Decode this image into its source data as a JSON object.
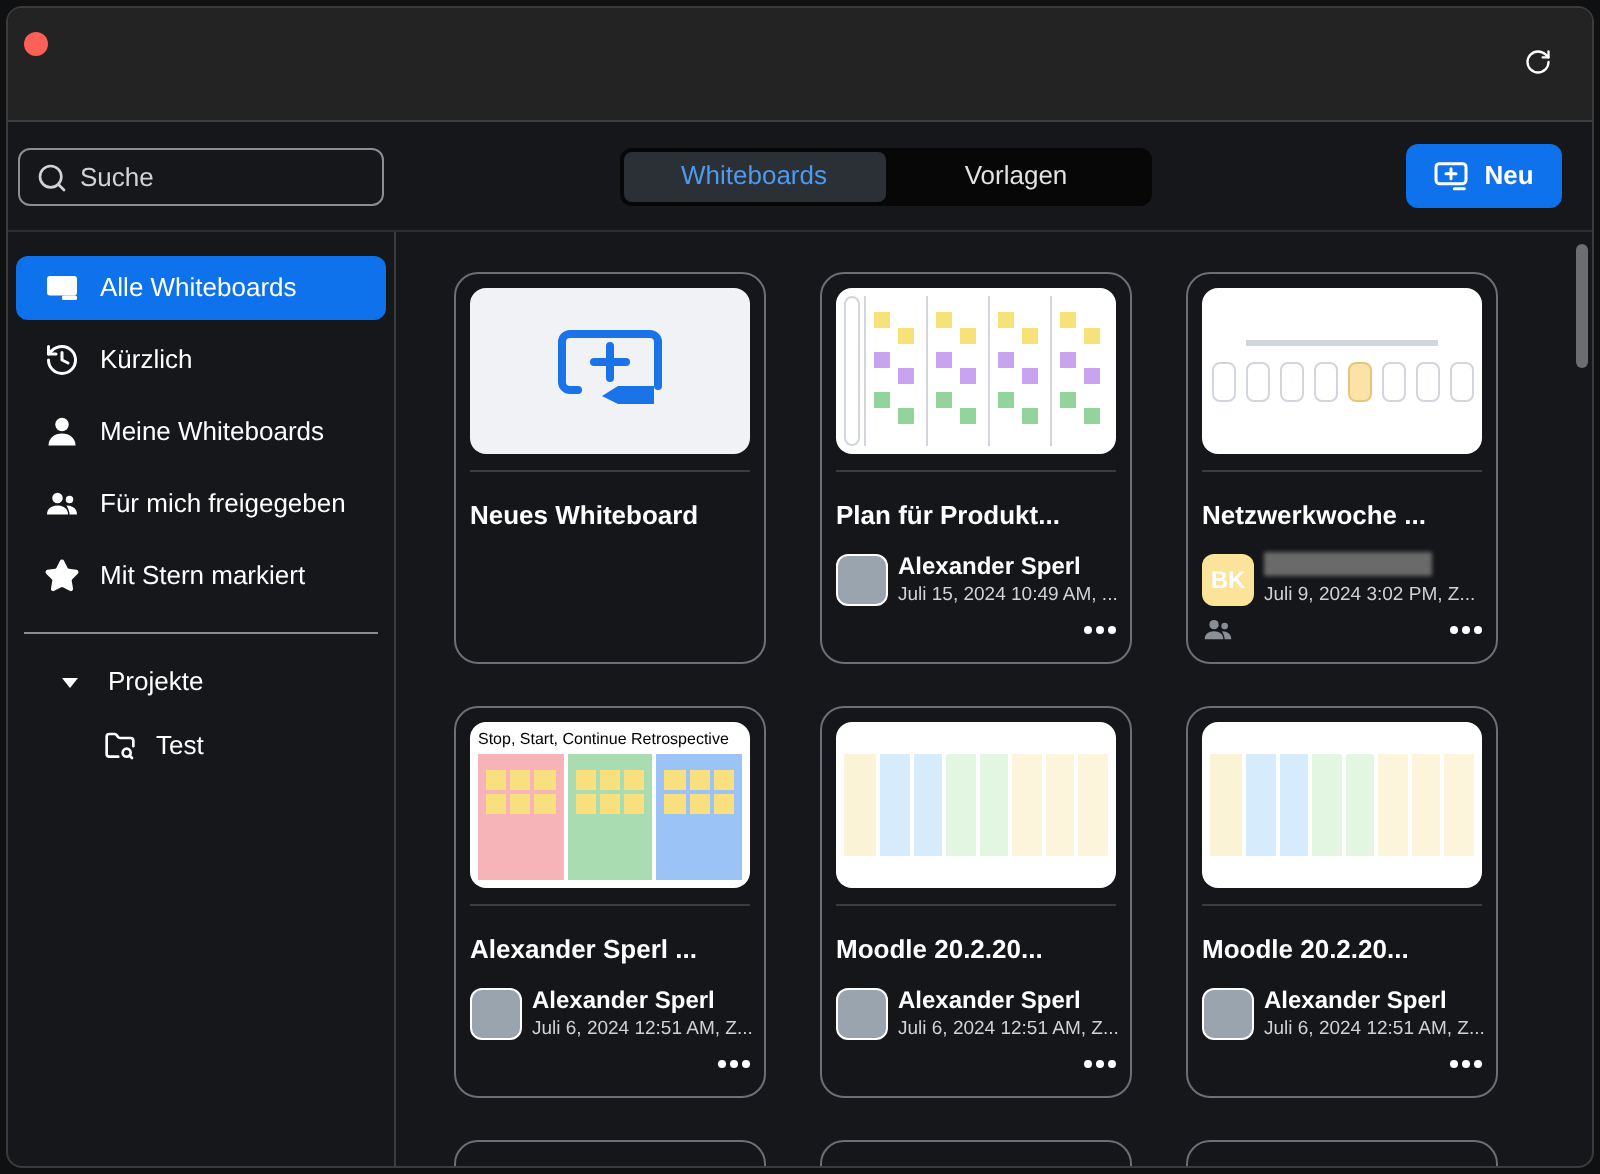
{
  "search": {
    "placeholder": "Suche"
  },
  "tabs": [
    {
      "label": "Whiteboards",
      "selected": true
    },
    {
      "label": "Vorlagen",
      "selected": false
    }
  ],
  "new_button": {
    "label": "Neu"
  },
  "sidebar": {
    "items": [
      {
        "label": "Alle Whiteboards",
        "selected": true
      },
      {
        "label": "Kürzlich",
        "selected": false
      },
      {
        "label": "Meine Whiteboards",
        "selected": false
      },
      {
        "label": "Für mich freigegeben",
        "selected": false
      },
      {
        "label": "Mit Stern markiert",
        "selected": false
      }
    ],
    "projects": {
      "label": "Projekte",
      "expanded": true,
      "children": [
        {
          "label": "Test"
        }
      ]
    }
  },
  "cards": [
    {
      "kind": "new",
      "title": "Neues Whiteboard"
    },
    {
      "kind": "board",
      "title": "Plan für Produkt...",
      "owner": "Alexander Sperl",
      "date": "Juli 15, 2024 10:49 AM, ...",
      "shared": false
    },
    {
      "kind": "board",
      "title": "Netzwerkwoche ...",
      "initials": "BK",
      "date": "Juli 9, 2024 3:02 PM, Z...",
      "shared": true
    },
    {
      "kind": "board",
      "thumbnail_title": "Stop, Start, Continue Retrospective",
      "title": "Alexander Sperl ...",
      "owner": "Alexander Sperl",
      "date": "Juli 6, 2024 12:51 AM, Z...",
      "shared": false
    },
    {
      "kind": "board",
      "title": "Moodle 20.2.20...",
      "owner": "Alexander Sperl",
      "date": "Juli 6, 2024 12:51 AM, Z...",
      "shared": false
    },
    {
      "kind": "board",
      "title": "Moodle 20.2.20...",
      "owner": "Alexander Sperl",
      "date": "Juli 6, 2024 12:51 AM, Z...",
      "shared": false
    }
  ]
}
